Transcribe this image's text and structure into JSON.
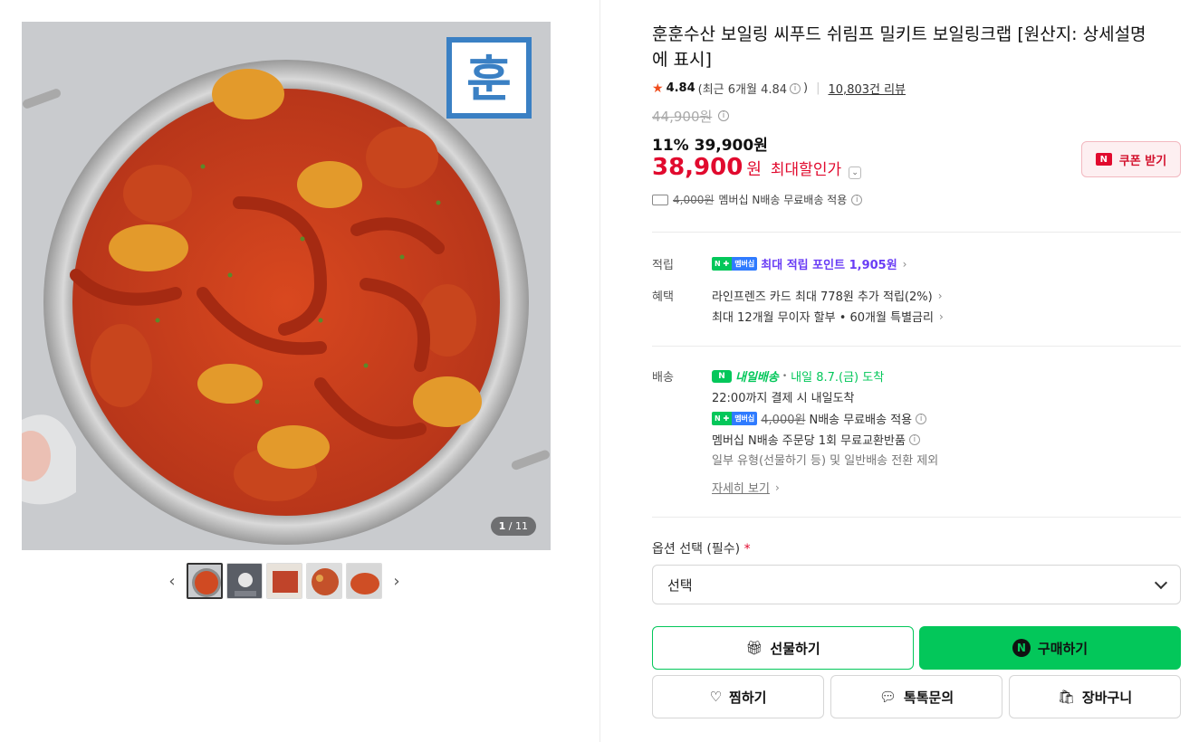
{
  "product": {
    "title": "훈훈수산 보일링 씨푸드 쉬림프 밀키트 보일링크랩 [원산지: 상세설명에 표시]",
    "image_counter_current": "1",
    "image_counter_total": "/ 11",
    "watermark": "훈"
  },
  "rating": {
    "score": "4.84",
    "recent": "(최근 6개월 4.84",
    "recent_close": ")",
    "reviews": "10,803건 리뷰"
  },
  "price": {
    "original": "44,900원",
    "discount": "11% 39,900원",
    "final_number": "38,900",
    "final_won": "원",
    "final_label": "최대할인가",
    "coupon_label": "쿠폰 받기",
    "shipping_fee": "4,000원",
    "shipping_text": "멤버십 N배송 무료배송 적용"
  },
  "benefits": {
    "points_label": "적립",
    "points_badge_n": "N ✚",
    "points_badge_m": "멤버십",
    "points_text": "최대 적립 포인트 1,905원",
    "perks_label": "혜택",
    "perk1": "라인프렌즈 카드 최대 778원 추가 적립(2%)",
    "perk2": "최대 12개월 무이자 할부 • 60개월 특별금리"
  },
  "delivery": {
    "label": "배송",
    "brand": "내일배송",
    "arrival": "내일 8.7.(금) 도착",
    "cutoff": "22:00까지 결제 시 내일도착",
    "fee": "4,000원",
    "fee_text": "N배송 무료배송 적용",
    "exchange": "멤버십 N배송 주문당 1회 무료교환반품",
    "exclusion": "일부 유형(선물하기 등) 및 일반배송 전환 제외",
    "more": "자세히 보기"
  },
  "options": {
    "label": "옵션 선택 (필수)",
    "required_mark": "*",
    "selected": "선택"
  },
  "buttons": {
    "gift": "선물하기",
    "buy": "구매하기",
    "wish": "찜하기",
    "talk": "톡톡문의",
    "cart": "장바구니"
  },
  "colors": {
    "accent_green": "#03c75a",
    "sale_red": "#e10a2e",
    "point_purple": "#6a3df5"
  }
}
